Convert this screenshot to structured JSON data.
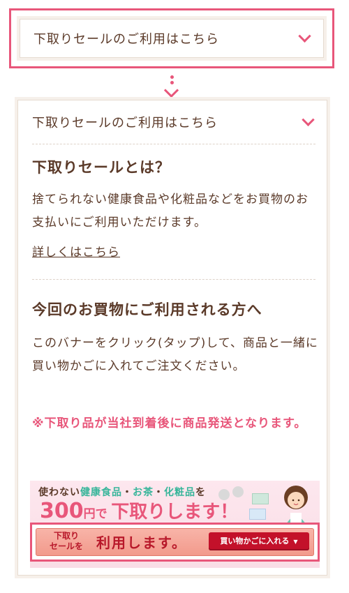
{
  "top_accordion": {
    "title": "下取りセールのご利用はこちら"
  },
  "expanded_accordion": {
    "title": "下取りセールのご利用はこちら",
    "section1": {
      "heading": "下取りセールとは？",
      "body": "捨てられない健康食品や化粧品などをお買物のお支払いにご利用いただけます。",
      "link": "詳しくはこちら"
    },
    "section2": {
      "heading": "今回のお買物にご利用される方へ",
      "body": "このバナーをクリック(タップ)して、商品と一緒に買い物かごに入れてご注文ください。",
      "note": "※下取り品が当社到着後に商品発送となります。"
    },
    "banner": {
      "line1_prefix": "使わない",
      "line1_item1": "健康食品",
      "line1_sep1": "・",
      "line1_item2": "お茶",
      "line1_sep2": "・",
      "line1_item3": "化粧品",
      "line1_suffix": "を",
      "price": "300",
      "price_unit": "円で",
      "price_action": "下取りします！",
      "cta_small": "下取り\nセールを",
      "cta_main": "利用します。",
      "cta_button": "買い物かごに入れる"
    }
  },
  "colors": {
    "accent_pink": "#e8567a",
    "text_brown": "#5b3a29",
    "panel_beige": "#f6f0ea",
    "button_red": "#c3112a",
    "highlight_green": "#37b59a"
  },
  "icons": [
    "chevron-down-icon",
    "arrow-down-icon",
    "person-illustration"
  ]
}
